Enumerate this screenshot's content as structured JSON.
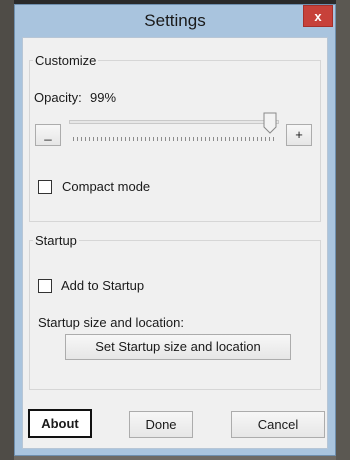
{
  "window": {
    "title": "Settings",
    "close_label": "x"
  },
  "customize": {
    "group_label": "Customize",
    "opacity_label": "Opacity:",
    "opacity_value": "99%",
    "opacity_fraction": 0.99,
    "decrease_label": "_",
    "increase_label": "+",
    "compact_mode_label": "Compact mode",
    "compact_mode_checked": false
  },
  "startup": {
    "group_label": "Startup",
    "add_to_startup_label": "Add to Startup",
    "add_to_startup_checked": false,
    "size_location_label": "Startup size and location:",
    "set_button_label": "Set Startup size and location"
  },
  "footer": {
    "about_label": "About",
    "done_label": "Done",
    "cancel_label": "Cancel"
  }
}
